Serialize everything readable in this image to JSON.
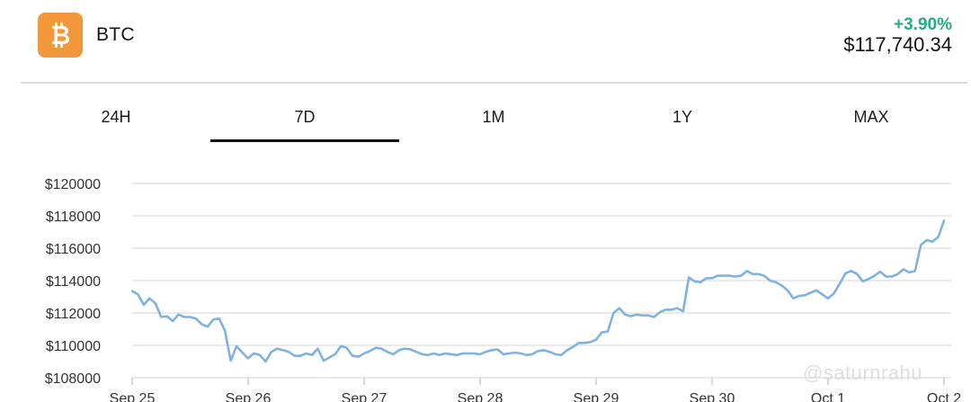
{
  "header": {
    "logo_icon": "bitcoin-icon",
    "symbol": "BTC",
    "change": "+3.90%",
    "price": "$117,740.34",
    "change_color": "#2aa986",
    "logo_color": "#f2973a"
  },
  "tabs": [
    {
      "label": "24H",
      "active": false
    },
    {
      "label": "7D",
      "active": true
    },
    {
      "label": "1M",
      "active": false
    },
    {
      "label": "1Y",
      "active": false
    },
    {
      "label": "MAX",
      "active": false
    }
  ],
  "watermark": "@saturnrahu",
  "chart_data": {
    "type": "line",
    "title": "",
    "xlabel": "",
    "ylabel": "",
    "line_color": "#7fb2e0",
    "grid": true,
    "yticks": [
      108000,
      110000,
      112000,
      114000,
      116000,
      118000,
      120000
    ],
    "ytick_labels": [
      "$108000",
      "$110000",
      "$112000",
      "$114000",
      "$116000",
      "$118000",
      "$120000"
    ],
    "ylim": [
      108000,
      120000
    ],
    "xticks": [
      {
        "label": "Sep 25",
        "day": 0
      },
      {
        "label": "Sep 26",
        "day": 1
      },
      {
        "label": "Sep 27",
        "day": 2
      },
      {
        "label": "Sep 28",
        "day": 3
      },
      {
        "label": "Sep 29",
        "day": 4
      },
      {
        "label": "Sep 30",
        "day": 5
      },
      {
        "label": "Oct 1",
        "day": 6
      },
      {
        "label": "Oct 2",
        "day": 7
      }
    ],
    "xlim": [
      0,
      7
    ],
    "series": [
      {
        "x": [
          0,
          0.05,
          0.1,
          0.15,
          0.2,
          0.25,
          0.3,
          0.35,
          0.4,
          0.45,
          0.5,
          0.55,
          0.6,
          0.65,
          0.7,
          0.75,
          0.8,
          0.85,
          0.9,
          0.95,
          1,
          1.05,
          1.1,
          1.15,
          1.2,
          1.25,
          1.3,
          1.35,
          1.4,
          1.45,
          1.5,
          1.55,
          1.6,
          1.65,
          1.7,
          1.75,
          1.8,
          1.85,
          1.9,
          1.95,
          2,
          2.05,
          2.1,
          2.15,
          2.2,
          2.25,
          2.3,
          2.35,
          2.4,
          2.45,
          2.5,
          2.55,
          2.6,
          2.65,
          2.7,
          2.75,
          2.8,
          2.85,
          2.9,
          2.95,
          3,
          3.05,
          3.1,
          3.15,
          3.2,
          3.25,
          3.3,
          3.35,
          3.4,
          3.45,
          3.5,
          3.55,
          3.6,
          3.65,
          3.7,
          3.75,
          3.8,
          3.85,
          3.9,
          3.95,
          4,
          4.05,
          4.1,
          4.15,
          4.2,
          4.25,
          4.3,
          4.35,
          4.4,
          4.45,
          4.5,
          4.55,
          4.6,
          4.65,
          4.7,
          4.75,
          4.8,
          4.85,
          4.9,
          4.95,
          5,
          5.05,
          5.1,
          5.15,
          5.2,
          5.25,
          5.3,
          5.35,
          5.4,
          5.45,
          5.5,
          5.55,
          5.6,
          5.65,
          5.7,
          5.75,
          5.8,
          5.85,
          5.9,
          5.95,
          6,
          6.05,
          6.1,
          6.15,
          6.2,
          6.25,
          6.3,
          6.35,
          6.4,
          6.45,
          6.5,
          6.55,
          6.6,
          6.65,
          6.7,
          6.75,
          6.8,
          6.85,
          6.9,
          6.95,
          7
        ],
        "values": [
          113350,
          113150,
          112500,
          112900,
          112600,
          111750,
          111800,
          111500,
          111900,
          111750,
          111750,
          111650,
          111300,
          111150,
          111600,
          111650,
          110900,
          109050,
          109950,
          109550,
          109200,
          109500,
          109400,
          109000,
          109600,
          109800,
          109700,
          109600,
          109350,
          109350,
          109500,
          109400,
          109800,
          109050,
          109250,
          109450,
          109950,
          109850,
          109350,
          109300,
          109500,
          109650,
          109850,
          109800,
          109600,
          109450,
          109700,
          109800,
          109750,
          109600,
          109450,
          109400,
          109500,
          109400,
          109500,
          109450,
          109400,
          109500,
          109500,
          109500,
          109450,
          109600,
          109700,
          109750,
          109450,
          109500,
          109550,
          109500,
          109400,
          109450,
          109650,
          109700,
          109600,
          109450,
          109400,
          109700,
          109900,
          110150,
          110150,
          110200,
          110350,
          110800,
          110850,
          112000,
          112300,
          111900,
          111800,
          111900,
          111850,
          111850,
          111750,
          112050,
          112200,
          112200,
          112300,
          112100,
          114200,
          113950,
          113900,
          114150,
          114150,
          114300,
          114300,
          114300,
          114250,
          114300,
          114600,
          114400,
          114400,
          114300,
          114000,
          113900,
          113700,
          113400,
          112900,
          113050,
          113100,
          113250,
          113400,
          113150,
          112900,
          113200,
          113800,
          114450,
          114600,
          114400,
          113950,
          114100,
          114300,
          114550,
          114250,
          114250,
          114400,
          114700,
          114500,
          114600,
          116200,
          116500,
          116400,
          116700,
          117700
        ]
      }
    ]
  }
}
